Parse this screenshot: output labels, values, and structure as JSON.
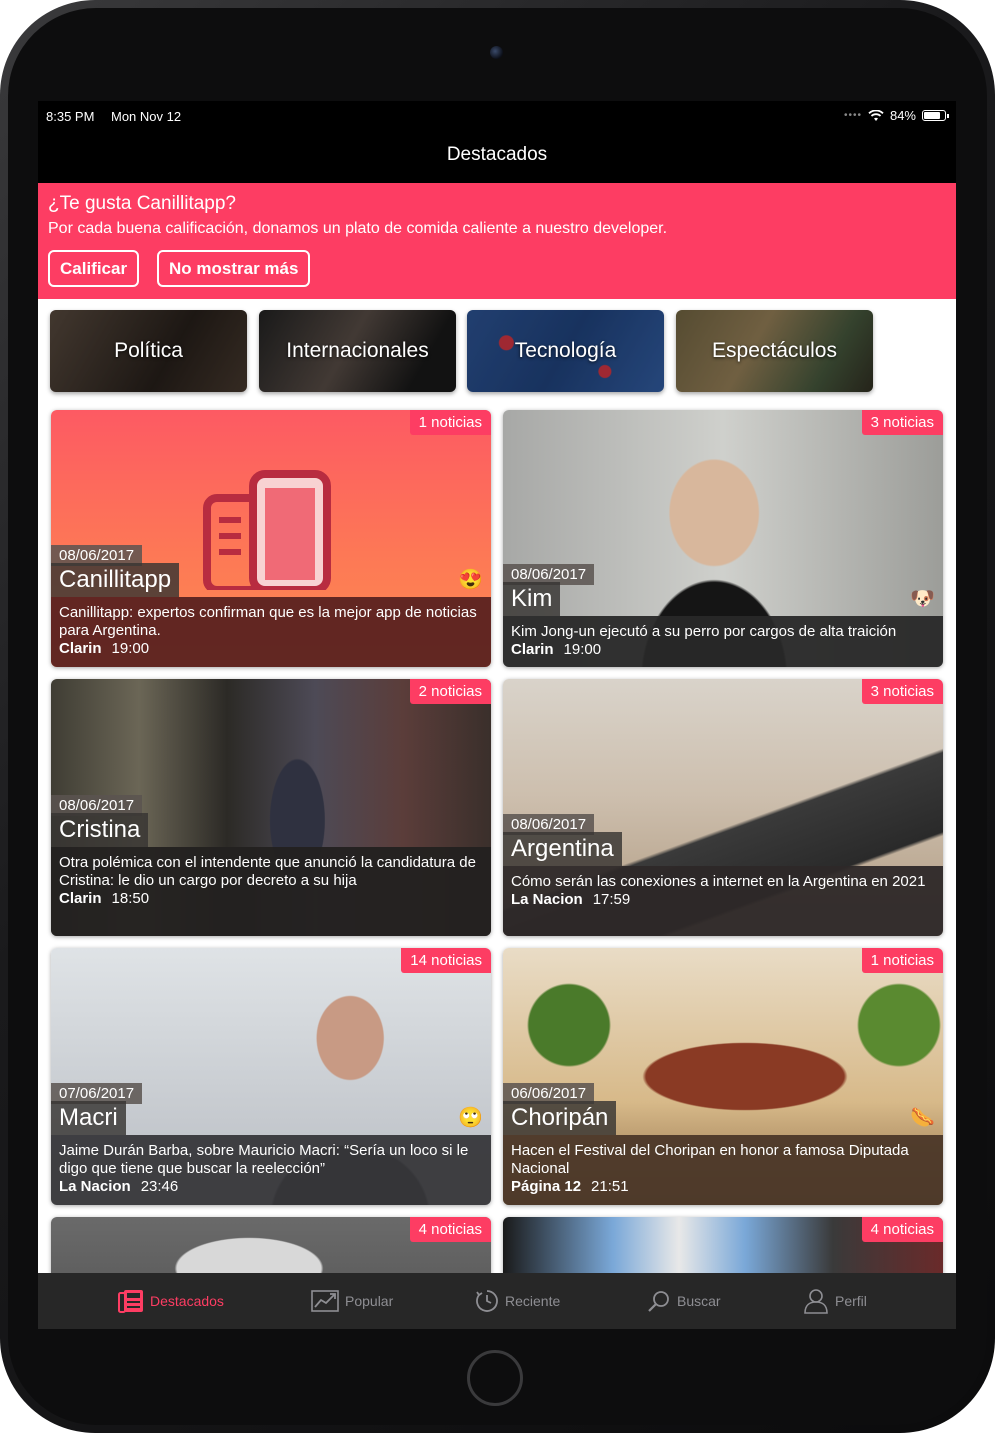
{
  "status": {
    "time": "8:35 PM",
    "date": "Mon Nov 12",
    "battery": "84%",
    "battery_level": 0.84
  },
  "nav": {
    "title": "Destacados"
  },
  "banner": {
    "title": "¿Te gusta Canillitapp?",
    "message": "Por cada buena calificación, donamos un plato de comida caliente a nuestro developer.",
    "rate_label": "Calificar",
    "dismiss_label": "No mostrar más"
  },
  "categories": [
    {
      "label": "Política"
    },
    {
      "label": "Internacionales"
    },
    {
      "label": "Tecnología"
    },
    {
      "label": "Espectáculos"
    }
  ],
  "cards": [
    {
      "count": "1 noticias",
      "date": "08/06/2017",
      "title": "Canillitapp",
      "emoji": "😍",
      "headline": "Canillitapp: expertos confirman que es la mejor app de noticias para Argentina.",
      "source": "Clarin",
      "time": "19:00"
    },
    {
      "count": "3 noticias",
      "date": "08/06/2017",
      "title": "Kim",
      "emoji": "🐶",
      "headline": "Kim Jong-un ejecutó a su perro por cargos de alta traición",
      "source": "Clarin",
      "time": "19:00"
    },
    {
      "count": "2 noticias",
      "date": "08/06/2017",
      "title": "Cristina",
      "emoji": "",
      "headline": "Otra polémica con el intendente que  anunció la candidatura de Cristina: le dio un cargo por decreto a su hija",
      "source": "Clarin",
      "time": "18:50"
    },
    {
      "count": "3 noticias",
      "date": "08/06/2017",
      "title": "Argentina",
      "emoji": "",
      "headline": "Cómo serán las conexiones a internet en la Argentina en 2021",
      "source": "La Nacion",
      "time": "17:59"
    },
    {
      "count": "14 noticias",
      "date": "07/06/2017",
      "title": "Macri",
      "emoji": "🙄",
      "headline": "Jaime Durán Barba, sobre Mauricio Macri: “Sería un loco si le digo que  tiene que buscar la reelección”",
      "source": "La Nacion",
      "time": "23:46"
    },
    {
      "count": "1 noticias",
      "date": "06/06/2017",
      "title": "Choripán",
      "emoji": "🌭",
      "headline": "Hacen el Festival del Choripan en honor a famosa Diputada Nacional",
      "source": "Página 12",
      "time": "21:51"
    },
    {
      "count": "4 noticias"
    },
    {
      "count": "4 noticias"
    }
  ],
  "tabs": [
    {
      "label": "Destacados",
      "icon": "newspaper-icon"
    },
    {
      "label": "Popular",
      "icon": "chart-icon"
    },
    {
      "label": "Reciente",
      "icon": "clock-icon"
    },
    {
      "label": "Buscar",
      "icon": "search-icon"
    },
    {
      "label": "Perfil",
      "icon": "user-icon"
    }
  ],
  "colors": {
    "accent": "#fd3d63",
    "tabbar": "#272727",
    "navbar": "#000000"
  }
}
